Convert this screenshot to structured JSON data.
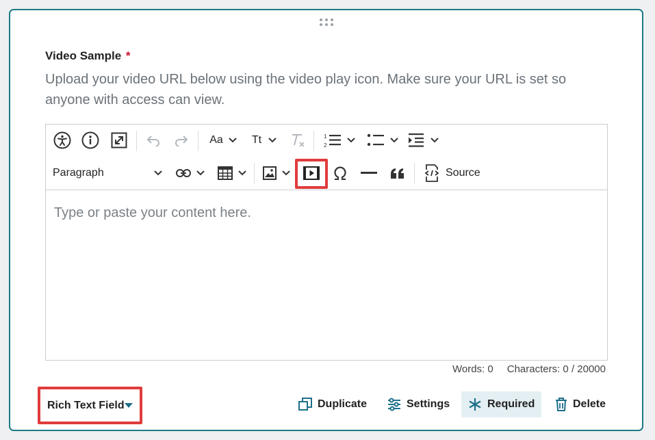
{
  "field": {
    "label": "Video Sample",
    "required_mark": "*",
    "description": "Upload your video URL below using the video play icon. Make sure your URL is set so anyone with access can view."
  },
  "toolbar": {
    "font_size_label": "Aa",
    "text_transform_label": "Tt",
    "heading_select_value": "Paragraph",
    "source_label": "Source"
  },
  "editor": {
    "placeholder": "Type or paste your content here."
  },
  "counts": {
    "words": "Words: 0",
    "characters": "Characters: 0 / 20000"
  },
  "field_type": {
    "selected": "Rich Text Field"
  },
  "actions": {
    "duplicate": "Duplicate",
    "settings": "Settings",
    "required": "Required",
    "delete": "Delete"
  },
  "colors": {
    "accent": "#1d7a85",
    "highlight": "#e03c3c",
    "required_star": "#c8102e"
  }
}
